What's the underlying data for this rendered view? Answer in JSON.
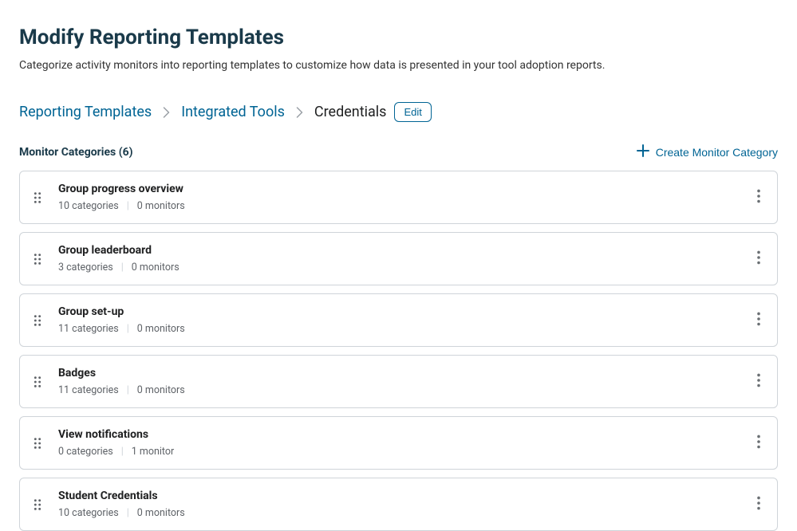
{
  "header": {
    "title": "Modify Reporting Templates",
    "description": "Categorize activity monitors into reporting templates to customize how data is presented in your tool adoption reports."
  },
  "breadcrumb": [
    {
      "label": "Reporting Templates",
      "link": true
    },
    {
      "label": "Integrated Tools",
      "link": true
    },
    {
      "label": "Credentials",
      "link": false
    }
  ],
  "editButton": "Edit",
  "section": {
    "title": "Monitor Categories (6)",
    "createLabel": "Create Monitor Category"
  },
  "items": [
    {
      "title": "Group progress overview",
      "categories": "10 categories",
      "monitors": "0 monitors"
    },
    {
      "title": "Group leaderboard",
      "categories": "3 categories",
      "monitors": "0 monitors"
    },
    {
      "title": "Group set-up",
      "categories": "11 categories",
      "monitors": "0 monitors"
    },
    {
      "title": "Badges",
      "categories": "11 categories",
      "monitors": "0 monitors"
    },
    {
      "title": "View notifications",
      "categories": "0 categories",
      "monitors": "1 monitor"
    },
    {
      "title": "Student Credentials",
      "categories": "10 categories",
      "monitors": "0 monitors"
    }
  ]
}
